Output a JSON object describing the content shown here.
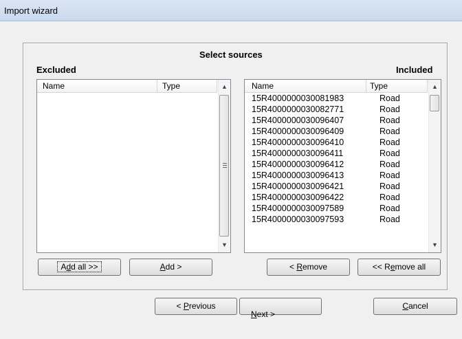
{
  "window": {
    "title": "Import wizard"
  },
  "page": {
    "heading": "Select sources"
  },
  "excluded": {
    "label": "Excluded",
    "columns": [
      "Name",
      "Type"
    ],
    "rows": []
  },
  "included": {
    "label": "Included",
    "columns": [
      "Name",
      "Type"
    ],
    "rows": [
      {
        "name": "15R4000000030081983",
        "type": "Road"
      },
      {
        "name": "15R4000000030082771",
        "type": "Road"
      },
      {
        "name": "15R4000000030096407",
        "type": "Road"
      },
      {
        "name": "15R4000000030096409",
        "type": "Road"
      },
      {
        "name": "15R4000000030096410",
        "type": "Road"
      },
      {
        "name": "15R4000000030096411",
        "type": "Road"
      },
      {
        "name": "15R4000000030096412",
        "type": "Road"
      },
      {
        "name": "15R4000000030096413",
        "type": "Road"
      },
      {
        "name": "15R4000000030096421",
        "type": "Road"
      },
      {
        "name": "15R4000000030096422",
        "type": "Road"
      },
      {
        "name": "15R4000000030097589",
        "type": "Road"
      },
      {
        "name": "15R4000000030097593",
        "type": "Road"
      }
    ]
  },
  "buttons": {
    "add_all": {
      "pre": "A",
      "key": "d",
      "post": "d all >>"
    },
    "add": {
      "pre": "",
      "key": "A",
      "post": "dd >"
    },
    "remove": {
      "pre": "< ",
      "key": "R",
      "post": "emove"
    },
    "remove_all": {
      "pre": "<< R",
      "key": "e",
      "post": "move all"
    },
    "previous": {
      "pre": "< ",
      "key": "P",
      "post": "revious"
    },
    "next": {
      "pre": "",
      "key": "N",
      "post": "ext >"
    },
    "cancel": {
      "pre": "",
      "key": "C",
      "post": "ancel"
    }
  },
  "icons": {
    "scroll_up": "▲",
    "scroll_down": "▼"
  }
}
